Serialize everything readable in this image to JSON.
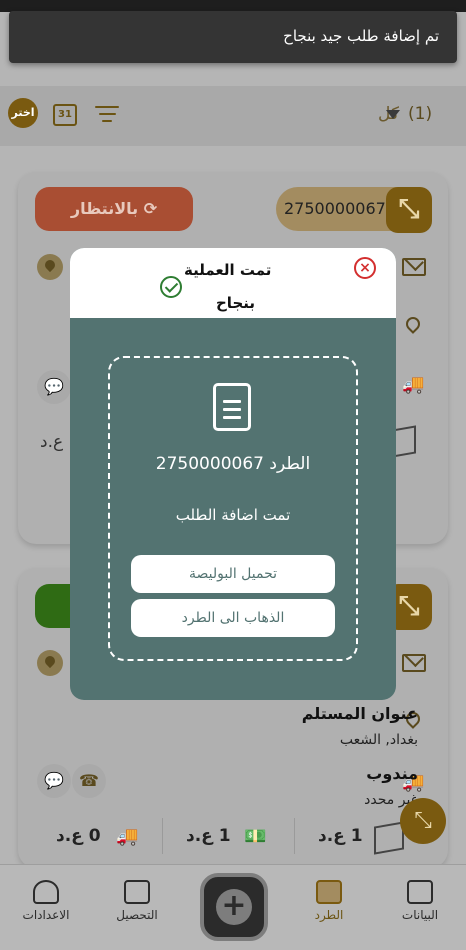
{
  "toast": {
    "message": "تم إضافة طلب جيد بنجاح"
  },
  "filter_bar": {
    "count": "(1)",
    "all_label": "كل",
    "choose_label": "اختر",
    "calendar_day": "31"
  },
  "card1": {
    "status_label": "بالانتظار",
    "tracking_number": "2750000067",
    "currency": "ع.د"
  },
  "card2": {
    "recipient_address_label": "عنوان المستلم",
    "recipient_address_value": "بغداد, الشعب",
    "delegate_label": "مندوب",
    "delegate_value": "غير محدد",
    "amounts": [
      {
        "value": "1",
        "currency": "ع.د"
      },
      {
        "value": "1",
        "currency": "ع.د"
      },
      {
        "value": "0",
        "currency": "ع.د"
      }
    ]
  },
  "dialog": {
    "title_line1": "تمت العملية",
    "title_line2": "بنجاح",
    "parcel_prefix": "الطرد",
    "parcel_number": "2750000067",
    "added_message": "تمت اضافة الطلب",
    "download_button": "تحميل البوليصة",
    "goto_button": "الذهاب الى الطرد"
  },
  "bottom_nav": {
    "items": [
      {
        "label": "البيانات"
      },
      {
        "label": "الطرد"
      },
      {
        "label": "التحصيل"
      },
      {
        "label": "الاعدادات"
      }
    ],
    "add_symbol": "+"
  },
  "colors": {
    "accent": "#7a5a10",
    "dialog_bg": "#537371",
    "pending": "#a94e33",
    "success": "#2f6b14"
  }
}
